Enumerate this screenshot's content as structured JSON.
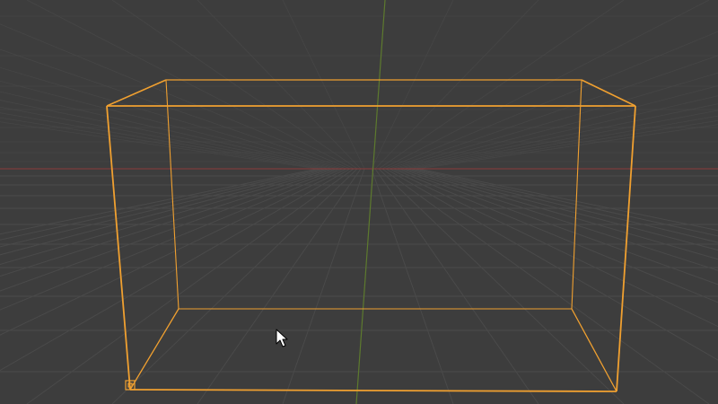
{
  "viewport": {
    "background_color": "#3d3d3d",
    "grid_color": "#4a4a4a",
    "x_axis_color": "#8c3a3a",
    "y_axis_color": "#5d7a2e",
    "selection_color": "#f0a030"
  },
  "scene": {
    "selected_object": "box-wireframe",
    "origin_marker_icon": "origin-square-icon",
    "cursor_icon": "mouse-pointer-icon"
  }
}
